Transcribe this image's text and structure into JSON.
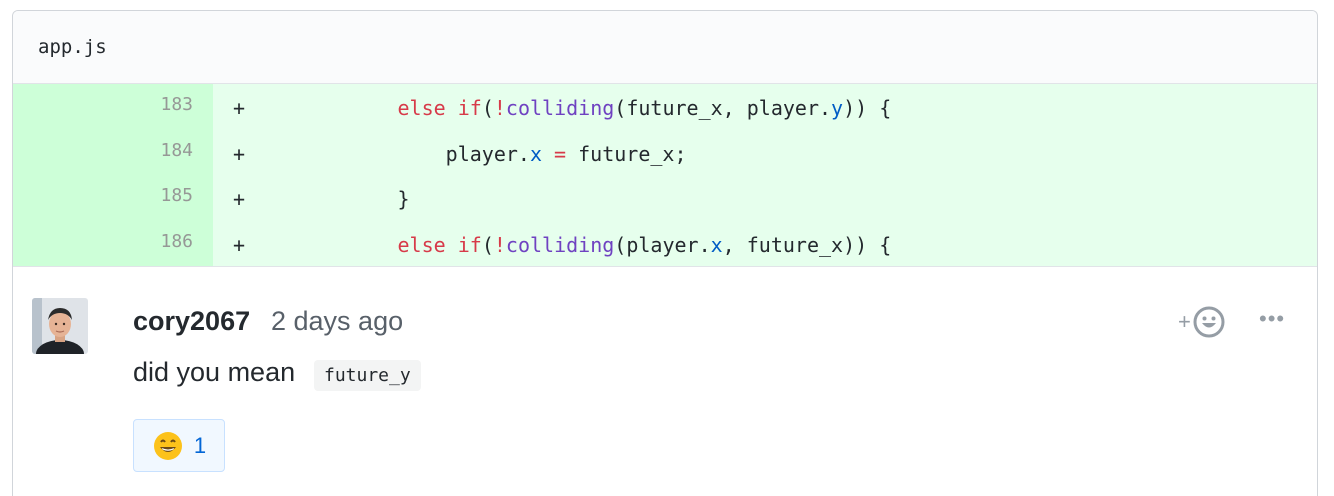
{
  "file": {
    "name": "app.js"
  },
  "diff": {
    "lines": [
      {
        "num": "183",
        "marker": "+"
      },
      {
        "num": "184",
        "marker": "+"
      },
      {
        "num": "185",
        "marker": "+"
      },
      {
        "num": "186",
        "marker": "+"
      }
    ],
    "code": {
      "l183": {
        "indent": "            ",
        "kw1": "else",
        "kw2": "if",
        "paren": "(",
        "bang": "!",
        "fn": "colliding",
        "a": "(future_x, player.",
        "prop": "y",
        "b": ")) {"
      },
      "l184": {
        "indent": "                ",
        "a": "player.",
        "prop": "x",
        "op": " = ",
        "b": "future_x;"
      },
      "l185": {
        "indent": "            ",
        "a": "}"
      },
      "l186": {
        "indent": "            ",
        "kw1": "else",
        "kw2": "if",
        "paren": "(",
        "bang": "!",
        "fn": "colliding",
        "a": "(player.",
        "prop": "x",
        "b": ", future_x)) {"
      }
    }
  },
  "comment": {
    "author": "cory2067",
    "timestamp": "2 days ago",
    "body": "did you mean",
    "code": "future_y",
    "add_reaction_label": "+",
    "more_label": "•••",
    "reaction": {
      "emoji_icon": "grinning-face-icon",
      "count": "1"
    }
  },
  "colors": {
    "added_bg": "#e6ffed",
    "added_num_bg": "#cdffd8",
    "keyword": "#d73a49",
    "function": "#6f42c1",
    "property": "#005cc5",
    "link": "#0366d6"
  }
}
